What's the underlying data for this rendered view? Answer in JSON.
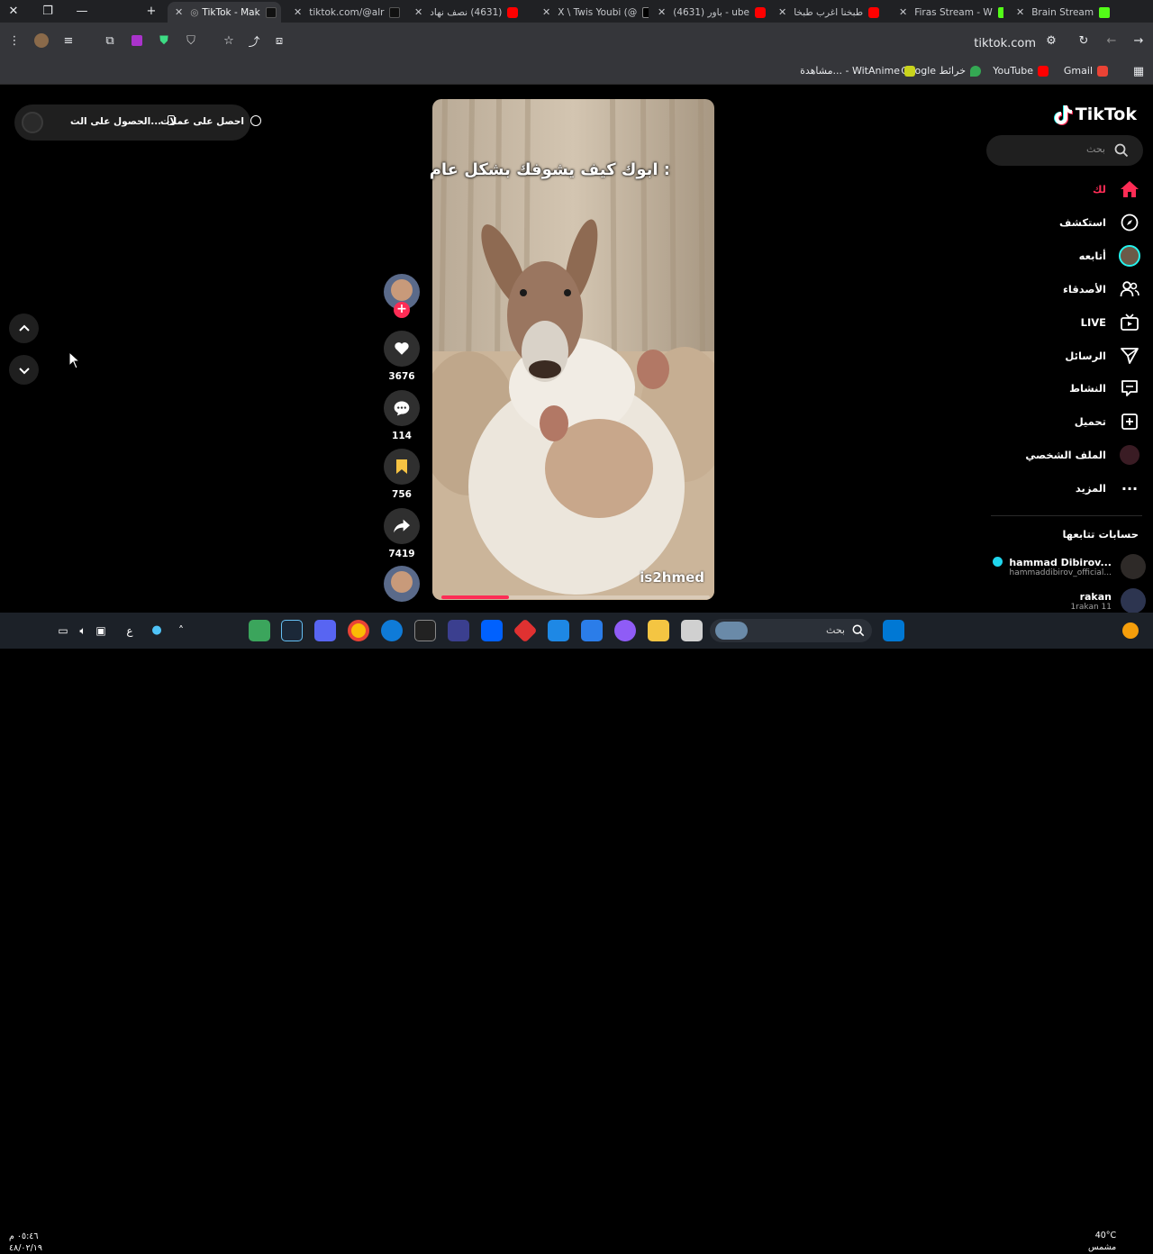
{
  "browser": {
    "tabs": [
      {
        "title": "TikTok - Mak",
        "active": true,
        "favicon": "tiktok-icon"
      },
      {
        "title": "tiktok.com/@alr",
        "active": false,
        "favicon": "tiktok-icon"
      },
      {
        "title": "(4631) نصف نهاد",
        "active": false,
        "favicon": "youtube-icon"
      },
      {
        "title": "X \\ Twis Youbi (@",
        "active": false,
        "favicon": "x-icon"
      },
      {
        "title": "(4631) باور - ube",
        "active": false,
        "favicon": "youtube-icon"
      },
      {
        "title": "طبخنا اغرب طبخا",
        "active": false,
        "favicon": "youtube-icon"
      },
      {
        "title": "Firas Stream - W",
        "active": false,
        "favicon": "kick-icon"
      },
      {
        "title": "Brain Stream",
        "active": false,
        "favicon": "kick-icon"
      }
    ],
    "url": "tiktok.com",
    "bookmarks": [
      {
        "label": "Gmail",
        "icon": "gmail-icon",
        "color": "#ea4335"
      },
      {
        "label": "YouTube",
        "icon": "youtube-icon",
        "color": "#ff0000"
      },
      {
        "label": "خرائط Google",
        "icon": "maps-icon",
        "color": "#34a853"
      },
      {
        "label": "مشاهدة... - WitAnime",
        "icon": "witanime-icon",
        "color": "#c9d31c"
      }
    ]
  },
  "promo": {
    "coins": "احصل على عملات",
    "app": "الحصول على الت..."
  },
  "video": {
    "caption": "ابوك كيف يشوفك بشكل عام :",
    "username": "is2hmed",
    "progress": 0.25
  },
  "actions": {
    "likes": "3676",
    "comments": "114",
    "saves": "756",
    "shares": "7419"
  },
  "sidebar": {
    "logo": "TikTok",
    "search_placeholder": "بحث",
    "nav": [
      {
        "label": "لك",
        "icon": "home-icon",
        "active": true
      },
      {
        "label": "استكشف",
        "icon": "compass-icon",
        "active": false
      },
      {
        "label": "أتابعه",
        "icon": "following-avatar-icon",
        "active": false
      },
      {
        "label": "الأصدقاء",
        "icon": "friends-icon",
        "active": false
      },
      {
        "label": "LIVE",
        "icon": "live-icon",
        "active": false
      },
      {
        "label": "الرسائل",
        "icon": "send-icon",
        "active": false
      },
      {
        "label": "النشاط",
        "icon": "inbox-icon",
        "active": false
      },
      {
        "label": "تحميل",
        "icon": "upload-icon",
        "active": false
      },
      {
        "label": "الملف الشخصي",
        "icon": "profile-avatar-icon",
        "active": false
      },
      {
        "label": "المزيد",
        "icon": "more-icon",
        "active": false
      }
    ],
    "following_title": "حسابات تتابعها",
    "accounts": [
      {
        "name": "hammad Dibirov...",
        "handle": "hammaddibirov_official...",
        "verified": true
      },
      {
        "name": "rakan",
        "handle": "1rakan 11",
        "verified": false
      }
    ]
  },
  "taskbar": {
    "search_placeholder": "بحث",
    "weather_temp": "40°C",
    "weather_desc": "مشمس",
    "time": "٠٥:٤٦ م",
    "date": "٤٨/٠٢/١٩",
    "lang": "ع"
  },
  "colors": {
    "accent": "#fe2c55",
    "save_yellow": "#f6c343",
    "bg": "#000000"
  }
}
